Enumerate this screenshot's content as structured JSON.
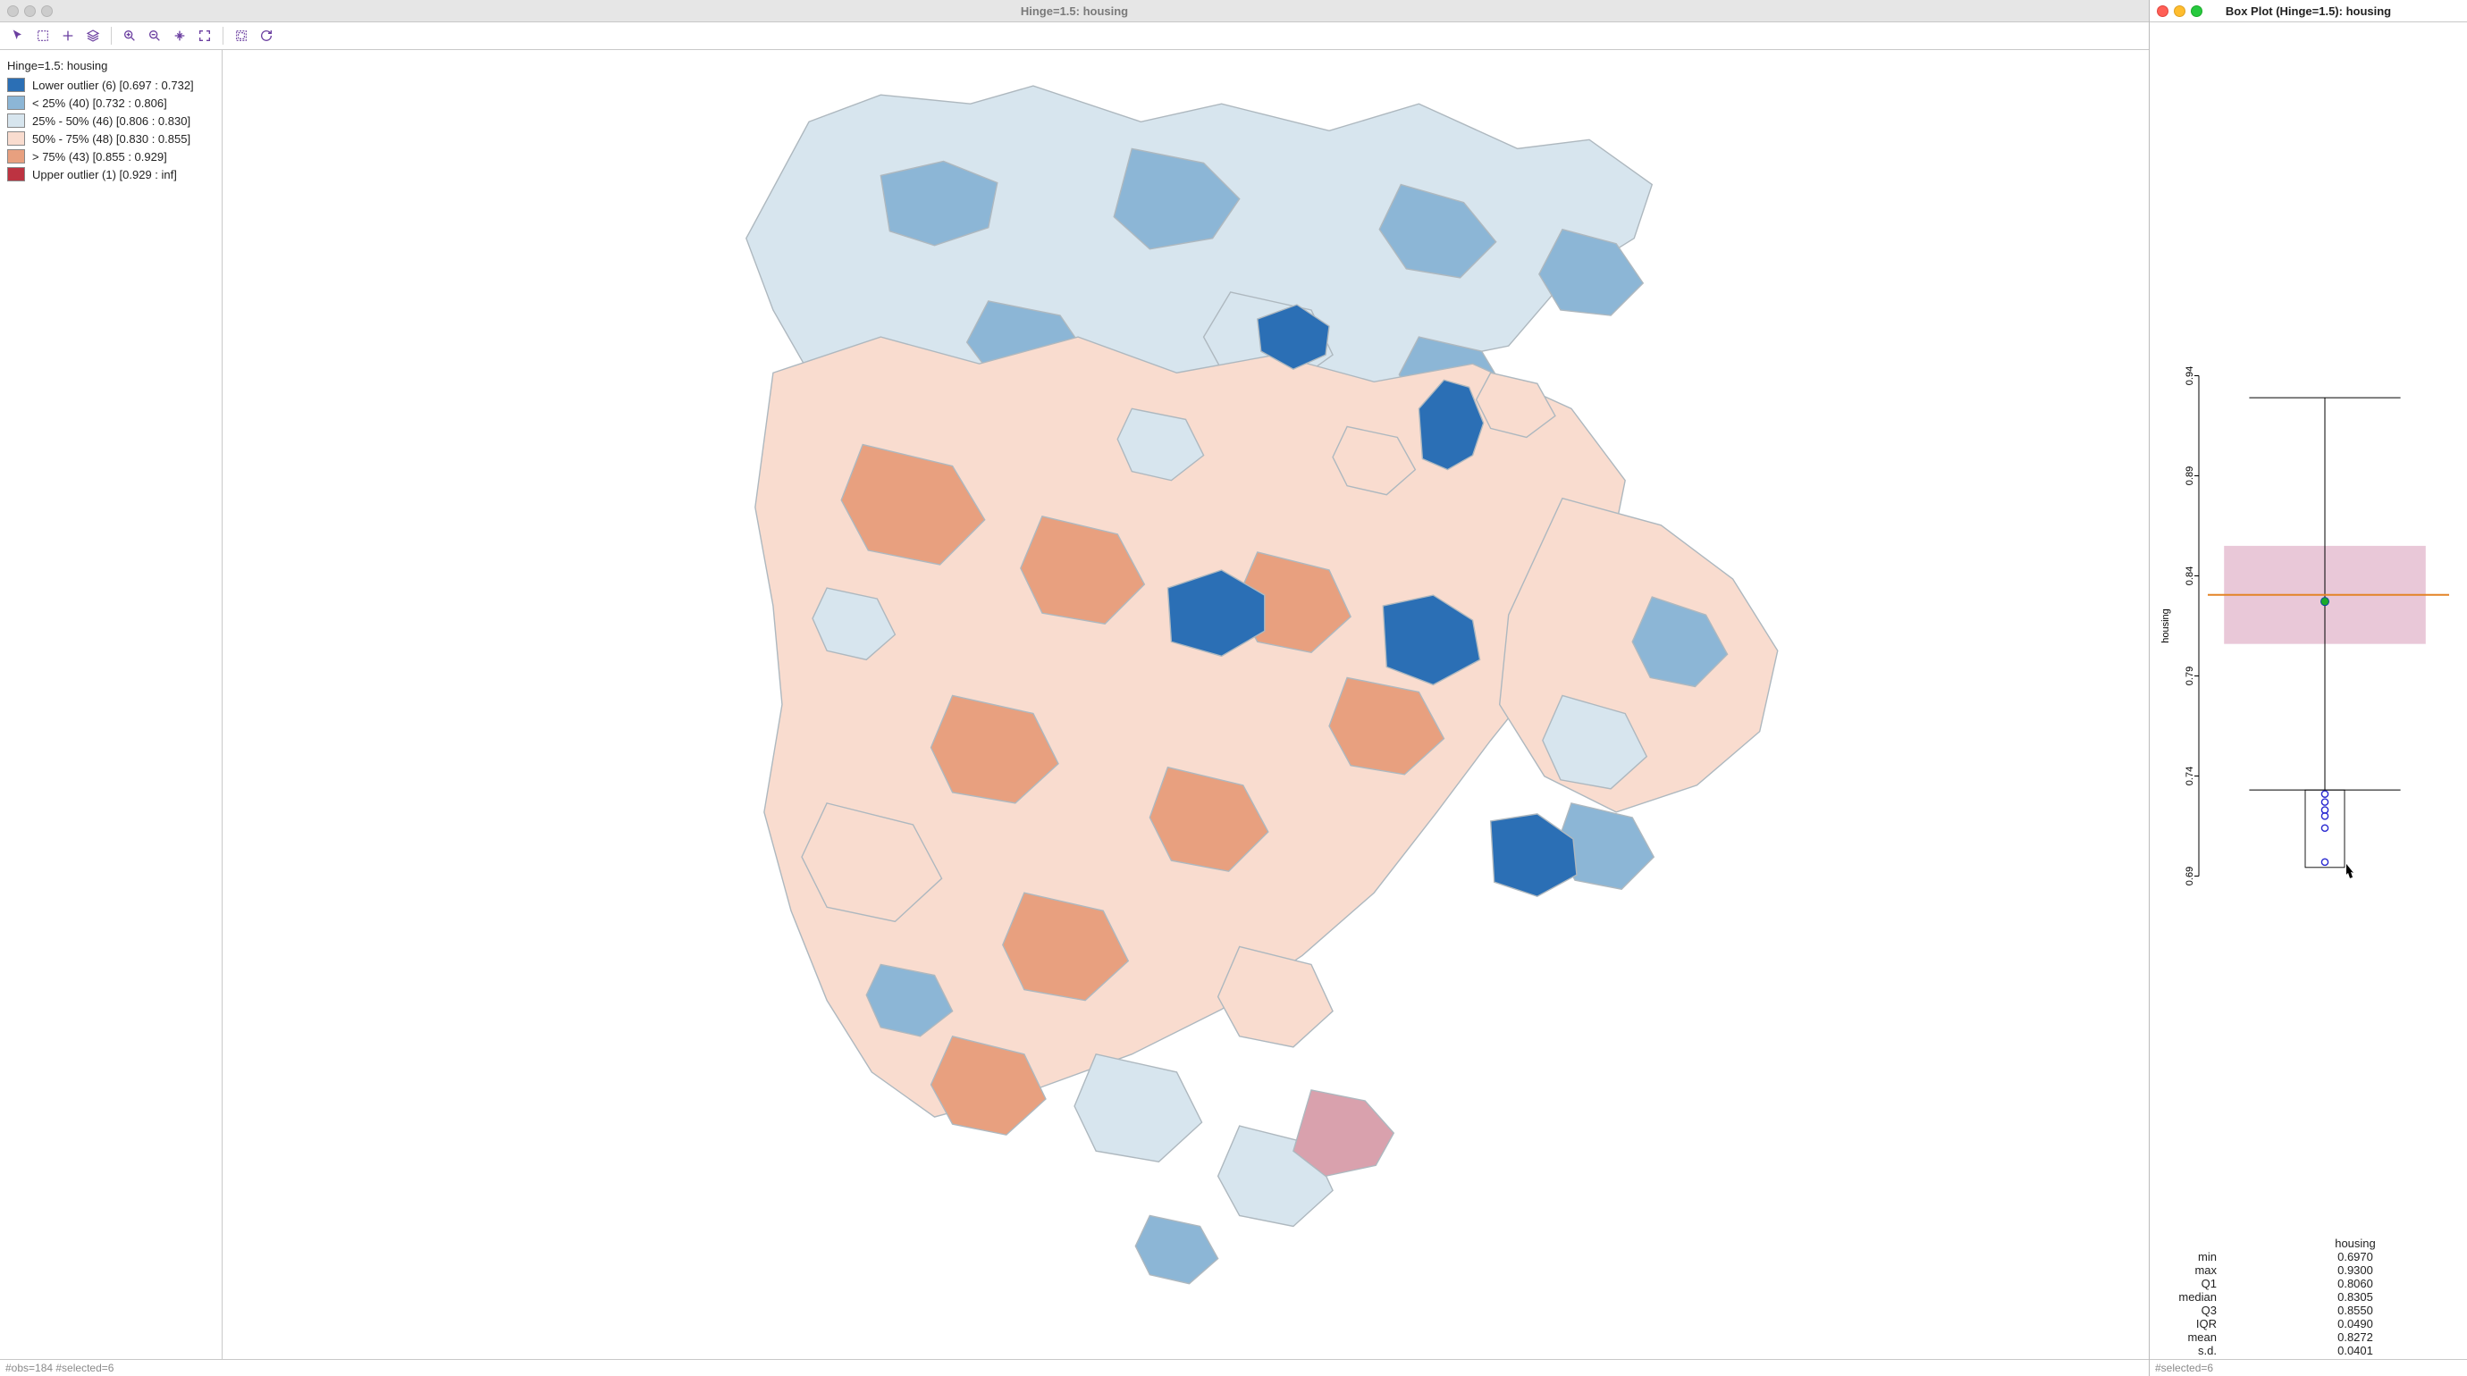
{
  "map_window": {
    "title": "Hinge=1.5: housing",
    "status": "#obs=184 #selected=6",
    "traffic_active": false
  },
  "toolbar": {
    "items": [
      {
        "name": "pointer-icon"
      },
      {
        "name": "select-rect-icon"
      },
      {
        "name": "pan-icon"
      },
      {
        "name": "layers-icon"
      },
      {
        "sep": true
      },
      {
        "name": "zoom-in-icon"
      },
      {
        "name": "zoom-out-icon"
      },
      {
        "name": "full-extent-icon"
      },
      {
        "name": "fit-icon"
      },
      {
        "sep": true
      },
      {
        "name": "basemap-icon"
      },
      {
        "name": "refresh-icon"
      }
    ]
  },
  "legend": {
    "title": "Hinge=1.5: housing",
    "items": [
      {
        "color": "#2b6fb5",
        "label": "Lower outlier (6)  [0.697 : 0.732]"
      },
      {
        "color": "#8cb6d6",
        "label": "< 25% (40)  [0.732 : 0.806]"
      },
      {
        "color": "#d7e5ee",
        "label": "25% - 50% (46)  [0.806 : 0.830]"
      },
      {
        "color": "#f9dccf",
        "label": "50% - 75% (48)  [0.830 : 0.855]"
      },
      {
        "color": "#e8a07f",
        "label": "> 75% (43)  [0.855 : 0.929]"
      },
      {
        "color": "#bd3341",
        "label": "Upper outlier (1)  [0.929 : inf]"
      }
    ]
  },
  "box_window": {
    "title": "Box Plot (Hinge=1.5): housing",
    "status": "#selected=6",
    "traffic_active": true,
    "x_label": "housing",
    "y_label": "housing",
    "y_ticks": [
      "0.69",
      "0.74",
      "0.79",
      "0.84",
      "0.89",
      "0.94"
    ],
    "stats": [
      {
        "label": "min",
        "value": "0.6970"
      },
      {
        "label": "max",
        "value": "0.9300"
      },
      {
        "label": "Q1",
        "value": "0.8060"
      },
      {
        "label": "median",
        "value": "0.8305"
      },
      {
        "label": "Q3",
        "value": "0.8550"
      },
      {
        "label": "IQR",
        "value": "0.0490"
      },
      {
        "label": "mean",
        "value": "0.8272"
      },
      {
        "label": "s.d.",
        "value": "0.0401"
      }
    ]
  },
  "chart_data": {
    "type": "boxplot",
    "variable": "housing",
    "ylim": [
      0.69,
      0.94
    ],
    "min": 0.697,
    "q1": 0.806,
    "median": 0.8305,
    "q3": 0.855,
    "max": 0.93,
    "mean": 0.8272,
    "sd": 0.0401,
    "iqr": 0.049,
    "whisker_low": 0.733,
    "whisker_high": 0.929,
    "outliers_low": [
      0.731,
      0.727,
      0.723,
      0.72,
      0.714,
      0.697
    ],
    "outliers_high": [],
    "selected_count": 6,
    "obs_count": 184
  },
  "colors": {
    "accent": "#6b3fa0",
    "box_fill": "#e9c8d8",
    "median": "#e38326",
    "mean": "#1aab29",
    "outlier": "#2828d0"
  }
}
